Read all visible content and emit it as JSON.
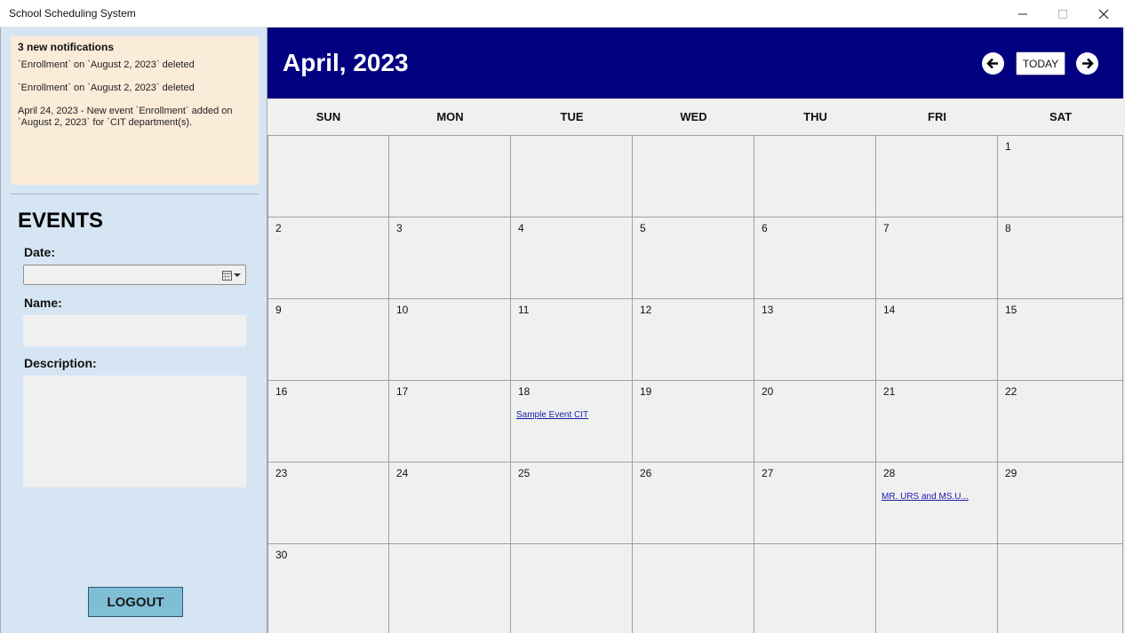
{
  "window": {
    "title": "School Scheduling System"
  },
  "sidebar": {
    "notifications": {
      "title": "3 new notifications",
      "items": [
        "`Enrollment` on `August 2, 2023` deleted",
        "`Enrollment` on `August 2, 2023` deleted",
        "April 24, 2023 - New event `Enrollment` added on `August 2, 2023` for `CIT department(s)."
      ]
    },
    "events_title": "EVENTS",
    "date_label": "Date:",
    "date_value": "",
    "name_label": "Name:",
    "name_value": "",
    "description_label": "Description:",
    "description_value": "",
    "logout_label": "LOGOUT"
  },
  "calendar": {
    "month_title": "April, 2023",
    "today_label": "TODAY",
    "weekdays": [
      "SUN",
      "MON",
      "TUE",
      "WED",
      "THU",
      "FRI",
      "SAT"
    ],
    "weeks": [
      [
        {
          "day": ""
        },
        {
          "day": ""
        },
        {
          "day": ""
        },
        {
          "day": ""
        },
        {
          "day": ""
        },
        {
          "day": ""
        },
        {
          "day": "1"
        }
      ],
      [
        {
          "day": "2"
        },
        {
          "day": "3"
        },
        {
          "day": "4"
        },
        {
          "day": "5"
        },
        {
          "day": "6"
        },
        {
          "day": "7"
        },
        {
          "day": "8"
        }
      ],
      [
        {
          "day": "9"
        },
        {
          "day": "10"
        },
        {
          "day": "11"
        },
        {
          "day": "12"
        },
        {
          "day": "13"
        },
        {
          "day": "14"
        },
        {
          "day": "15"
        }
      ],
      [
        {
          "day": "16"
        },
        {
          "day": "17"
        },
        {
          "day": "18",
          "event": "Sample Event CIT"
        },
        {
          "day": "19"
        },
        {
          "day": "20"
        },
        {
          "day": "21"
        },
        {
          "day": "22"
        }
      ],
      [
        {
          "day": "23"
        },
        {
          "day": "24"
        },
        {
          "day": "25"
        },
        {
          "day": "26"
        },
        {
          "day": "27"
        },
        {
          "day": "28",
          "event": "MR. URS and MS.U..."
        },
        {
          "day": "29"
        }
      ],
      [
        {
          "day": "30"
        },
        {
          "day": ""
        },
        {
          "day": ""
        },
        {
          "day": ""
        },
        {
          "day": ""
        },
        {
          "day": ""
        },
        {
          "day": ""
        }
      ]
    ]
  },
  "colors": {
    "header_bg": "#000080",
    "sidebar_bg": "#d6e5f3",
    "notification_bg": "#fbebd9",
    "logout_bg": "#7fbfd6",
    "event_link": "#1a1aa6"
  },
  "icons": {
    "minimize": "minimize-icon",
    "maximize": "maximize-icon",
    "close": "close-icon",
    "prev": "arrow-left-icon",
    "next": "arrow-right-icon",
    "calendar": "calendar-icon",
    "dropdown": "chevron-down-icon"
  }
}
